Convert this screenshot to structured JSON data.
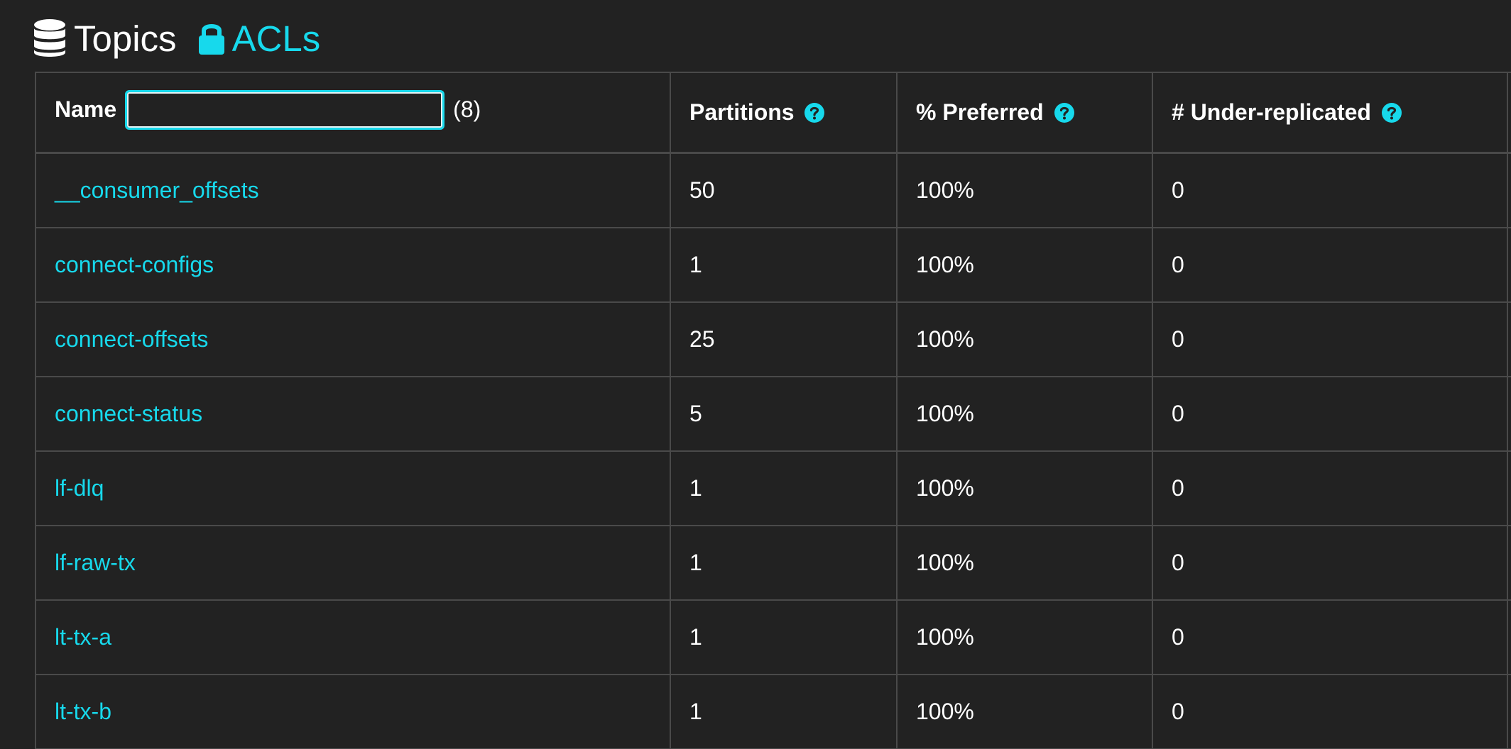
{
  "header": {
    "topics_label": "Topics",
    "acls_label": "ACLs"
  },
  "table": {
    "columns": {
      "name": "Name",
      "partitions": "Partitions",
      "preferred": "% Preferred",
      "under_replicated": "# Under-replicated"
    },
    "filter": {
      "value": "",
      "placeholder": ""
    },
    "count_label": "(8)",
    "rows": [
      {
        "name": "__consumer_offsets",
        "partitions": "50",
        "preferred": "100%",
        "under_replicated": "0"
      },
      {
        "name": "connect-configs",
        "partitions": "1",
        "preferred": "100%",
        "under_replicated": "0"
      },
      {
        "name": "connect-offsets",
        "partitions": "25",
        "preferred": "100%",
        "under_replicated": "0"
      },
      {
        "name": "connect-status",
        "partitions": "5",
        "preferred": "100%",
        "under_replicated": "0"
      },
      {
        "name": "lf-dlq",
        "partitions": "1",
        "preferred": "100%",
        "under_replicated": "0"
      },
      {
        "name": "lf-raw-tx",
        "partitions": "1",
        "preferred": "100%",
        "under_replicated": "0"
      },
      {
        "name": "lt-tx-a",
        "partitions": "1",
        "preferred": "100%",
        "under_replicated": "0"
      },
      {
        "name": "lt-tx-b",
        "partitions": "1",
        "preferred": "100%",
        "under_replicated": "0"
      }
    ]
  },
  "icons": {
    "topics": "database-icon",
    "acls": "lock-icon",
    "help": "question-circle-icon"
  },
  "colors": {
    "accent": "#17d9ec",
    "background": "#222222",
    "border": "#4a4a4a",
    "text": "#ffffff"
  }
}
